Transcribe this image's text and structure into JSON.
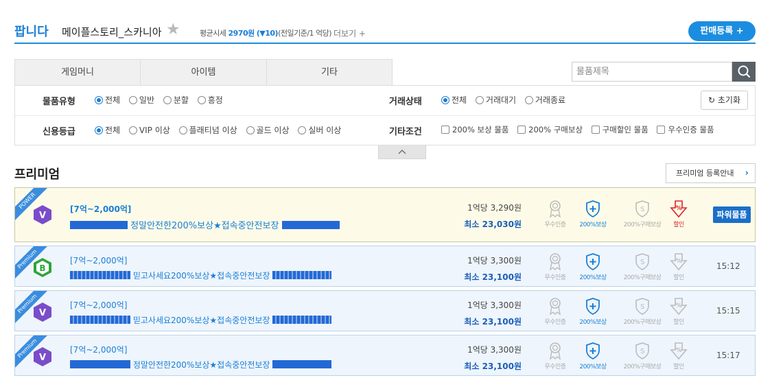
{
  "header": {
    "brand": "팝니다",
    "game_server": "메이플스토리_스카니아",
    "avg_label": "평균시세",
    "avg_price": "2970원",
    "change": "(▼10)",
    "basis": "(전일기준/1 억당)",
    "more": "더보기 +",
    "sell_button": "판매등록 +"
  },
  "tabs": [
    "게임머니",
    "아이템",
    "기타"
  ],
  "search": {
    "placeholder": "물품제목"
  },
  "filters": {
    "item_type": {
      "label": "물품유형",
      "options": [
        "전체",
        "일반",
        "분할",
        "흥정"
      ],
      "selected": "전체"
    },
    "trade_state": {
      "label": "거래상태",
      "options": [
        "전체",
        "거래대기",
        "거래종료"
      ],
      "selected": "전체"
    },
    "credit": {
      "label": "신용등급",
      "options": [
        "전체",
        "VIP 이상",
        "플래티넘 이상",
        "골드 이상",
        "실버 이상"
      ],
      "selected": "전체"
    },
    "other": {
      "label": "기타조건",
      "options": [
        "200% 보상 물품",
        "200% 구매보상",
        "구매할인 물품",
        "우수인증 물품"
      ]
    },
    "reset": "초기화"
  },
  "premium": {
    "title": "프리미엄",
    "guide_button": "프리미엄 등록안내",
    "badge_labels": [
      "우수인증",
      "200%보상",
      "200%구매보상",
      "할인"
    ],
    "rows": [
      {
        "ribbon": "POWER",
        "grade": "V",
        "range": "[7억~2,000억]",
        "title": "정말안전한200%보상★접속중안전보장",
        "unit_price": "1억당 3,290원",
        "min_price": "최소 23,030원",
        "action": "파워물품",
        "time": ""
      },
      {
        "ribbon": "Premium",
        "grade": "B",
        "range": "[7억~2,000억]",
        "title": "믿고사세요200%보상★접속중안전보장",
        "unit_price": "1억당 3,300원",
        "min_price": "최소 23,100원",
        "action": "",
        "time": "15:12"
      },
      {
        "ribbon": "Premium",
        "grade": "V",
        "range": "[7억~2,000억]",
        "title": "믿고사세요200%보상★접속중안전보장",
        "unit_price": "1억당 3,300원",
        "min_price": "최소 23,100원",
        "action": "",
        "time": "15:15"
      },
      {
        "ribbon": "Premium",
        "grade": "V",
        "range": "[7억~2,000억]",
        "title": "정말안전한200%보상★접속중안전보장",
        "unit_price": "1억당 3,300원",
        "min_price": "최소 23,100원",
        "action": "",
        "time": "15:17"
      }
    ]
  },
  "colors": {
    "accent": "#1b8de0",
    "grade_v": "#7b4cc9",
    "grade_b": "#2fa53a"
  }
}
